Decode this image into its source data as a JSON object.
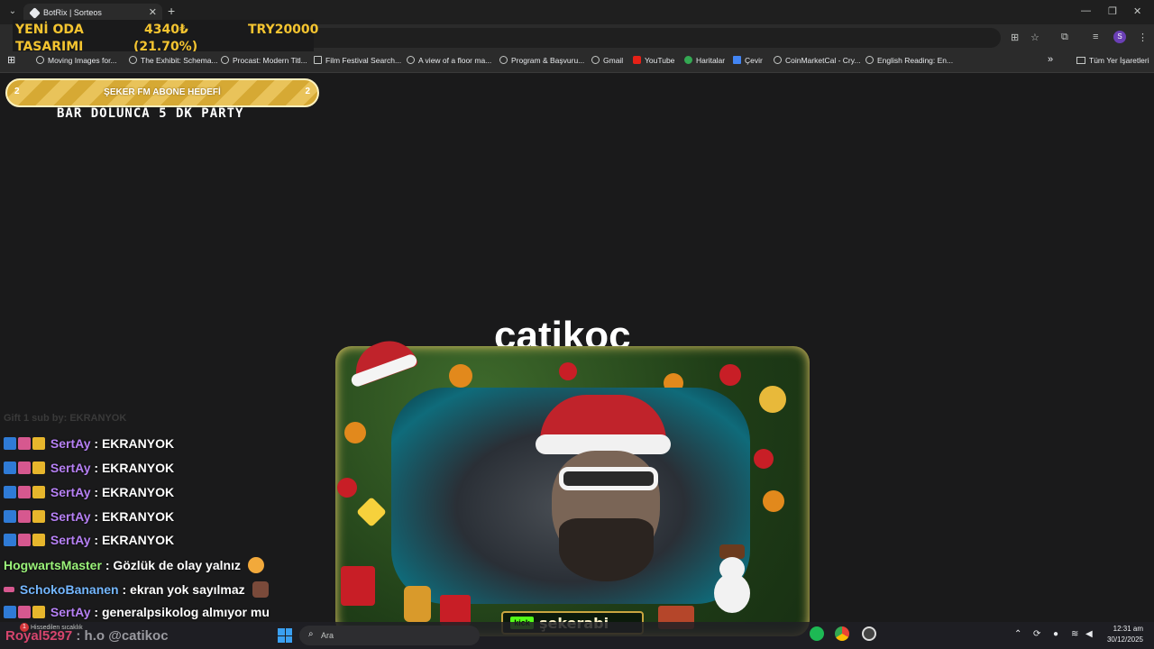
{
  "browser": {
    "tab_title": "BotRix | Sorteos",
    "bookmarks": [
      "Moving Images for...",
      "The Exhibit: Schema...",
      "Procast: Modern Titl...",
      "Film Festival Search...",
      "A view of a floor ma...",
      "Program & Başvuru...",
      "Gmail",
      "YouTube",
      "Haritalar",
      "Çevir",
      "CoinMarketCal - Cry...",
      "English Reading: En..."
    ],
    "all_bookmarks": "Tüm Yer İşaretleri",
    "profile_initial": "S"
  },
  "overlay": {
    "project_line1": "YENİ ODA",
    "project_line2": "TASARIMI",
    "amount": "4340₺",
    "percent": "(21.70%)",
    "target": "TRY20000",
    "goal_left": "2",
    "goal_label": "ŞEKER FM ABONE HEDEFİ",
    "goal_right": "2",
    "goal_subtitle": "BAR DOLUNCA 5 DK PARTY",
    "streamer_name": "catikoc",
    "kick_logo": "kick",
    "kick_name": "şekerabi",
    "faded_line": "Gift 1 sub by: EKRANYOK"
  },
  "chat": [
    {
      "user": "SertAy",
      "text": ": EKRANYOK",
      "style": "sert"
    },
    {
      "user": "SertAy",
      "text": ": EKRANYOK",
      "style": "sert"
    },
    {
      "user": "SertAy",
      "text": ": EKRANYOK",
      "style": "sert"
    },
    {
      "user": "SertAy",
      "text": ": EKRANYOK",
      "style": "sert"
    },
    {
      "user": "SertAy",
      "text": ": EKRANYOK",
      "style": "sert"
    },
    {
      "user": "HogwartsMaster",
      "text": ": Gözlük de olay yalnız",
      "style": "hog"
    },
    {
      "user": "SchokoBananen",
      "text": ": ekran yok sayılmaz",
      "style": "sch"
    },
    {
      "user": "SertAy",
      "text": ": generalpsikolog almıyor mu",
      "style": "sert"
    }
  ],
  "last_line": {
    "user": "Royal5297",
    "text": ": h.o @catikoc"
  },
  "taskbar": {
    "search_placeholder": "Ara",
    "notification_count": "1",
    "notification_text": "Hissedilen sıcaklık",
    "time": "12:31 am",
    "date": "30/12/2025"
  },
  "colors": {
    "gold": "#f4c430",
    "sert": "#b680f4",
    "hog": "#9bf37a",
    "sch": "#74b7ff",
    "kick_green": "#53fc18"
  }
}
